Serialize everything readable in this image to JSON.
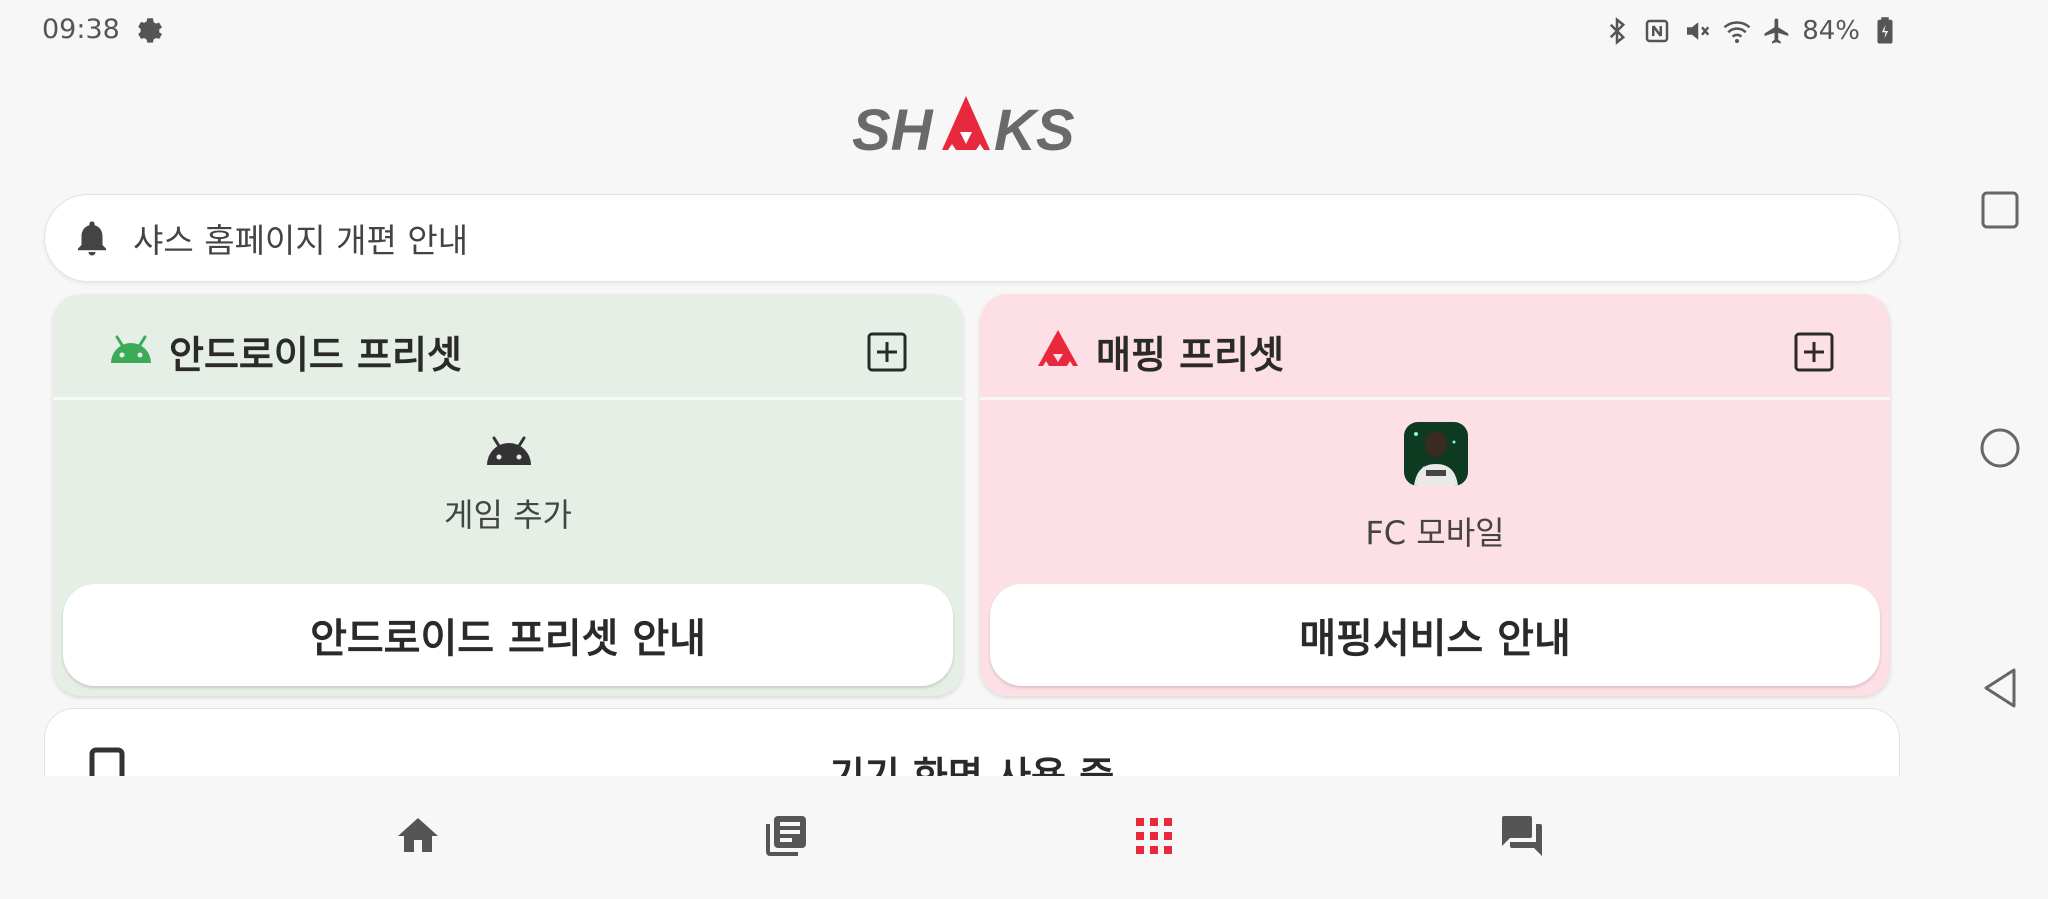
{
  "status_bar": {
    "time": "09:38",
    "battery_text": "84%",
    "icons": [
      "settings-gear-icon",
      "bluetooth-icon",
      "nfc-icon",
      "mute-icon",
      "wifi-icon",
      "airplane-icon",
      "battery-icon"
    ]
  },
  "logo": {
    "text": "SHAKS",
    "accent_color": "#e8283c",
    "color": "#666666"
  },
  "notice": {
    "icon": "bell-icon",
    "text": "샤스 홈페이지 개편 안내"
  },
  "android_preset": {
    "title": "안드로이드 프리셋",
    "icon": "android-icon",
    "icon_color": "#3daa5a",
    "add_icon": "add-box-icon",
    "body_label": "게임 추가",
    "button_label": "안드로이드 프리셋 안내",
    "background": "#e6efe6"
  },
  "mapping_preset": {
    "title": "매핑 프리셋",
    "icon": "shaks-triangle-icon",
    "add_icon": "add-box-icon",
    "game_label": "FC 모바일",
    "button_label": "매핑서비스 안내",
    "background": "#fde0e5"
  },
  "device_card": {
    "icon": "phone-icon",
    "text": "기기 화면 사용 중"
  },
  "bottom_nav": {
    "items": [
      {
        "name": "home",
        "icon": "home-icon",
        "active": false
      },
      {
        "name": "news",
        "icon": "article-icon",
        "active": false
      },
      {
        "name": "apps",
        "icon": "grid-icon",
        "active": true
      },
      {
        "name": "chat",
        "icon": "forum-icon",
        "active": false
      }
    ],
    "active_color": "#e8283c",
    "inactive_color": "#555555"
  },
  "system_nav": {
    "icons": [
      "recents-icon",
      "home-circle-icon",
      "back-icon"
    ]
  }
}
